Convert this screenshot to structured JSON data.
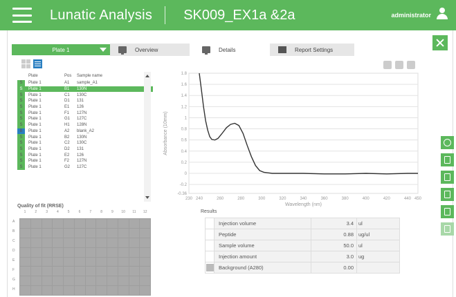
{
  "header": {
    "app_title": "Lunatic Analysis",
    "experiment": "SK009_EX1a &2a",
    "user": "administrator",
    "color": "#5cb85c"
  },
  "toolbar": {
    "plate_select": "Plate 1",
    "tabs": [
      {
        "label": "Overview",
        "icon": "monitor-icon"
      },
      {
        "label": "Details",
        "icon": "monitor-icon"
      },
      {
        "label": "Report Settings",
        "icon": "report-icon"
      }
    ]
  },
  "table": {
    "headers": [
      "Plate",
      "Pos",
      "Sample name"
    ],
    "rows": [
      {
        "status": "S",
        "plate": "Plate 1",
        "pos": "A1",
        "name": "sample_A1"
      },
      {
        "status": "S",
        "plate": "Plate 1",
        "pos": "B1",
        "name": "130N"
      },
      {
        "status": "S",
        "plate": "Plate 1",
        "pos": "C1",
        "name": "130C"
      },
      {
        "status": "S",
        "plate": "Plate 1",
        "pos": "D1",
        "name": "131"
      },
      {
        "status": "S",
        "plate": "Plate 1",
        "pos": "E1",
        "name": "126"
      },
      {
        "status": "S",
        "plate": "Plate 1",
        "pos": "F1",
        "name": "127N"
      },
      {
        "status": "S",
        "plate": "Plate 1",
        "pos": "G1",
        "name": "127C"
      },
      {
        "status": "S",
        "plate": "Plate 1",
        "pos": "H1",
        "name": "128N"
      },
      {
        "status": "B",
        "plate": "Plate 1",
        "pos": "A2",
        "name": "blank_A2"
      },
      {
        "status": "S",
        "plate": "Plate 1",
        "pos": "B2",
        "name": "130N"
      },
      {
        "status": "S",
        "plate": "Plate 1",
        "pos": "C2",
        "name": "130C"
      },
      {
        "status": "S",
        "plate": "Plate 1",
        "pos": "D2",
        "name": "131"
      },
      {
        "status": "S",
        "plate": "Plate 1",
        "pos": "E2",
        "name": "126"
      },
      {
        "status": "S",
        "plate": "Plate 1",
        "pos": "F2",
        "name": "127N"
      },
      {
        "status": "S",
        "plate": "Plate 1",
        "pos": "G2",
        "name": "127C"
      }
    ]
  },
  "quality": {
    "title": "Quality of fit (RRSE)",
    "columns": [
      "1",
      "2",
      "3",
      "4",
      "5",
      "6",
      "7",
      "8",
      "9",
      "10",
      "11",
      "12"
    ],
    "rows": [
      "A",
      "B",
      "C",
      "D",
      "E",
      "F",
      "G",
      "H"
    ]
  },
  "chart_data": {
    "type": "line",
    "xlabel": "Wavelength (nm)",
    "ylabel": "Absorbance (10mm)",
    "xlim": [
      230,
      450
    ],
    "ylim": [
      -0.36,
      1.8
    ],
    "xticks": [
      "230",
      "240",
      "260",
      "280",
      "300",
      "320",
      "340",
      "360",
      "380",
      "400",
      "420",
      "440",
      "450"
    ],
    "yticks": [
      "1.8",
      "1.6",
      "1.4",
      "1.2",
      "1",
      "0.8",
      "0.6",
      "0.4",
      "0.2",
      "0",
      "-0.2",
      "-0.36"
    ],
    "x": [
      240,
      242,
      244,
      246,
      248,
      250,
      252,
      255,
      258,
      262,
      266,
      270,
      274,
      278,
      282,
      286,
      290,
      294,
      298,
      302,
      306,
      310,
      320,
      340,
      360,
      380,
      400,
      420,
      440,
      450
    ],
    "y": [
      1.8,
      1.5,
      1.2,
      0.95,
      0.78,
      0.66,
      0.61,
      0.6,
      0.63,
      0.72,
      0.82,
      0.88,
      0.9,
      0.86,
      0.72,
      0.5,
      0.3,
      0.14,
      0.05,
      0.02,
      0.01,
      0.0,
      0.0,
      0.0,
      -0.01,
      -0.01,
      0.0,
      -0.01,
      0.0,
      0.0
    ]
  },
  "results": {
    "title": "Results",
    "rows": [
      {
        "name": "Injection volume",
        "value": "3.4",
        "unit": "ul",
        "swatch": false
      },
      {
        "name": "Peptide",
        "value": "0.88",
        "unit": "ug/ul",
        "swatch": false
      },
      {
        "name": "Sample volume",
        "value": "50.0",
        "unit": "ul",
        "swatch": false
      },
      {
        "name": "Injection amount",
        "value": "3.0",
        "unit": "ug",
        "swatch": false
      },
      {
        "name": "Background (A280)",
        "value": "0.00",
        "unit": "",
        "swatch": true
      }
    ]
  },
  "sidebar": [
    "info-icon",
    "chart-icon",
    "document-icon",
    "save-icon",
    "monitor-icon",
    "report-icon"
  ]
}
